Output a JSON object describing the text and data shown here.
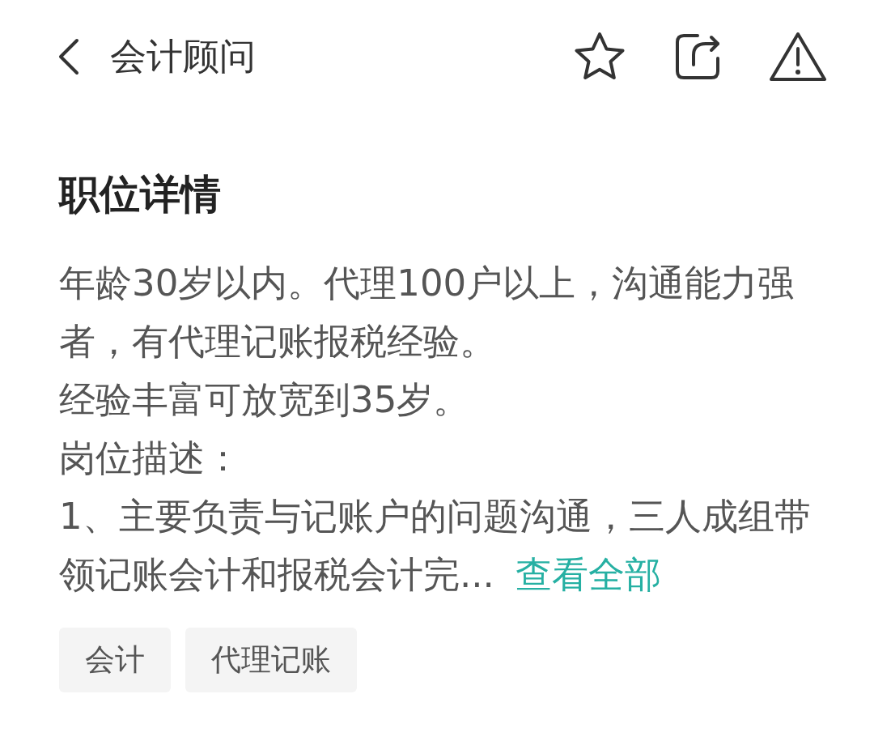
{
  "header": {
    "title": "会计顾问",
    "favorited": false
  },
  "section": {
    "heading": "职位详情",
    "description": {
      "lines": [
        "年龄30岁以内。代理100户以上，沟通能力强者，有代理记账报税经验。",
        "经验丰富可放宽到35岁。",
        "岗位描述：",
        "1、主要负责与记账户的问题沟通，三人成组带领记账会计和报税会计完..."
      ],
      "view_all_link": "查看全部"
    },
    "tags": [
      "会计",
      "代理记账"
    ]
  }
}
